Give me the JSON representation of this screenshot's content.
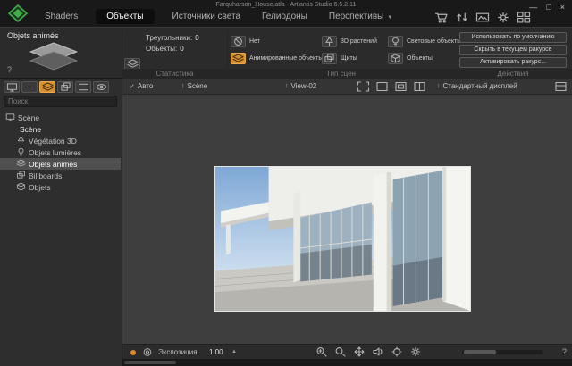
{
  "window": {
    "title": "Farquharson_House.atla - Artlantis Studio 6.5.2.11"
  },
  "icons": {
    "dropdown": "▼",
    "updown": "↕",
    "check": "✓",
    "minimize": "—",
    "maximize": "□",
    "close": "×",
    "help": "?",
    "stepper_up": "▲"
  },
  "colors": {
    "accent_orange": "#d8902f",
    "logo_green": "#3fae49"
  },
  "tabs": {
    "items": [
      {
        "label": "Shaders"
      },
      {
        "label": "Объекты",
        "active": true
      },
      {
        "label": "Источники света"
      },
      {
        "label": "Гелиодоны"
      },
      {
        "label": "Перспективы"
      }
    ]
  },
  "inspector": {
    "title": "Objets animés"
  },
  "stats": {
    "section_label": "Статистика",
    "rows": [
      {
        "label": "Треугольники:",
        "value": "0"
      },
      {
        "label": "Объекты:",
        "value": "0"
      }
    ]
  },
  "scene_types": {
    "section_label": "Тип сцен",
    "items": [
      {
        "label": "Нет"
      },
      {
        "label": "Анимированные объекты",
        "active": true
      },
      {
        "label": "3D растений"
      },
      {
        "label": "Щиты"
      },
      {
        "label": "Световые объекты"
      },
      {
        "label": "Объекты"
      }
    ]
  },
  "actions": {
    "section_label": "Действия",
    "buttons": [
      {
        "label": "Использовать по умолчанию"
      },
      {
        "label": "Скрыть в текущем ракурсе"
      },
      {
        "label": "Активировать ракурс..."
      }
    ]
  },
  "sidebar": {
    "search_placeholder": "Поиск",
    "tree": [
      {
        "label": "Scène"
      },
      {
        "label": "Scène"
      },
      {
        "label": "Végétation 3D"
      },
      {
        "label": "Objets lumières"
      },
      {
        "label": "Objets animés",
        "selected": true
      },
      {
        "label": "Billboards"
      },
      {
        "label": "Objets"
      }
    ]
  },
  "viewport": {
    "auto_label": "Авто",
    "scene_select": "Scène",
    "view_select": "View-02",
    "display_select": "Стандартный дисплей"
  },
  "bottom": {
    "exposure_label": "Экспозиция",
    "exposure_value": "1.00"
  }
}
